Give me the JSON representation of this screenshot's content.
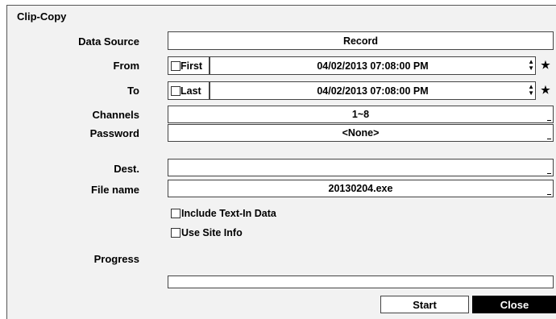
{
  "dialog": {
    "title": "Clip-Copy"
  },
  "fields": {
    "data_source": {
      "label": "Data Source",
      "value": "Record"
    },
    "from": {
      "label": "From",
      "checkbox_label": "First",
      "value": "04/02/2013  07:08:00 PM"
    },
    "to": {
      "label": "To",
      "checkbox_label": "Last",
      "value": "04/02/2013  07:08:00 PM"
    },
    "channels": {
      "label": "Channels",
      "value": "1~8"
    },
    "password": {
      "label": "Password",
      "value": "<None>"
    },
    "dest": {
      "label": "Dest.",
      "value": ""
    },
    "file_name": {
      "label": "File name",
      "value": "20130204.exe"
    }
  },
  "options": {
    "include_text_in": {
      "label": "Include Text-In Data",
      "checked": false
    },
    "use_site_info": {
      "label": "Use Site Info",
      "checked": false
    }
  },
  "progress": {
    "label": "Progress",
    "fraction": 0
  },
  "buttons": {
    "start": "Start",
    "close": "Close"
  },
  "colors": {
    "dialog_bg": "#f2f2f2",
    "close_bg": "#000000",
    "close_text": "#ffffff"
  },
  "icons": {
    "star": "star-icon",
    "spinner": "spinner-arrows-icon"
  }
}
